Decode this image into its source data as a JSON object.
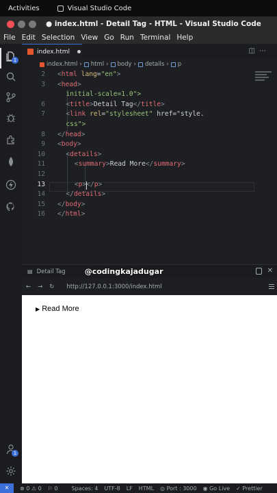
{
  "os": {
    "activities": "Activities",
    "app_name": "Visual Studio Code"
  },
  "window": {
    "title": "● index.html - Detail Tag - HTML - Visual Studio Code"
  },
  "menu": [
    "File",
    "Edit",
    "Selection",
    "View",
    "Go",
    "Run",
    "Terminal",
    "Help"
  ],
  "activity_badges": {
    "source_control": "",
    "account": "1"
  },
  "tab": {
    "name": "index.html"
  },
  "breadcrumb": [
    "index.html",
    "html",
    "body",
    "details",
    "p"
  ],
  "editor": {
    "lines": [
      {
        "num": "2",
        "text": "<html lang=\"en\">"
      },
      {
        "num": "3",
        "text": "<head>"
      },
      {
        "num": "",
        "text": "initial-scale=1.0\">"
      },
      {
        "num": "6",
        "text": "<title>Detail Tag</title>"
      },
      {
        "num": "7",
        "text": "<link rel=\"stylesheet\" href=\"style."
      },
      {
        "num": "",
        "text": "css\">"
      },
      {
        "num": "8",
        "text": "</head>"
      },
      {
        "num": "9",
        "text": "<body>"
      },
      {
        "num": "10",
        "text": "<details>"
      },
      {
        "num": "11",
        "text": "<summary>Read More</summary>"
      },
      {
        "num": "12",
        "text": ""
      },
      {
        "num": "13",
        "text": "<p></p>"
      },
      {
        "num": "14",
        "text": "</details>"
      },
      {
        "num": "15",
        "text": "</body>"
      },
      {
        "num": "16",
        "text": "</html>"
      }
    ],
    "current_line": "13"
  },
  "browser": {
    "tab_title": "Detail Tag",
    "watermark": "@codingkajadugar",
    "url": "http://127.0.0.1:3000/index.html",
    "summary_text": "Read More"
  },
  "status": {
    "errors": "0",
    "warnings": "0",
    "info": "0",
    "spaces": "Spaces: 4",
    "encoding": "UTF-8",
    "eol": "LF",
    "language": "HTML",
    "port": "Port : 3000",
    "golive": "Go Live",
    "prettier": "Prettier"
  }
}
